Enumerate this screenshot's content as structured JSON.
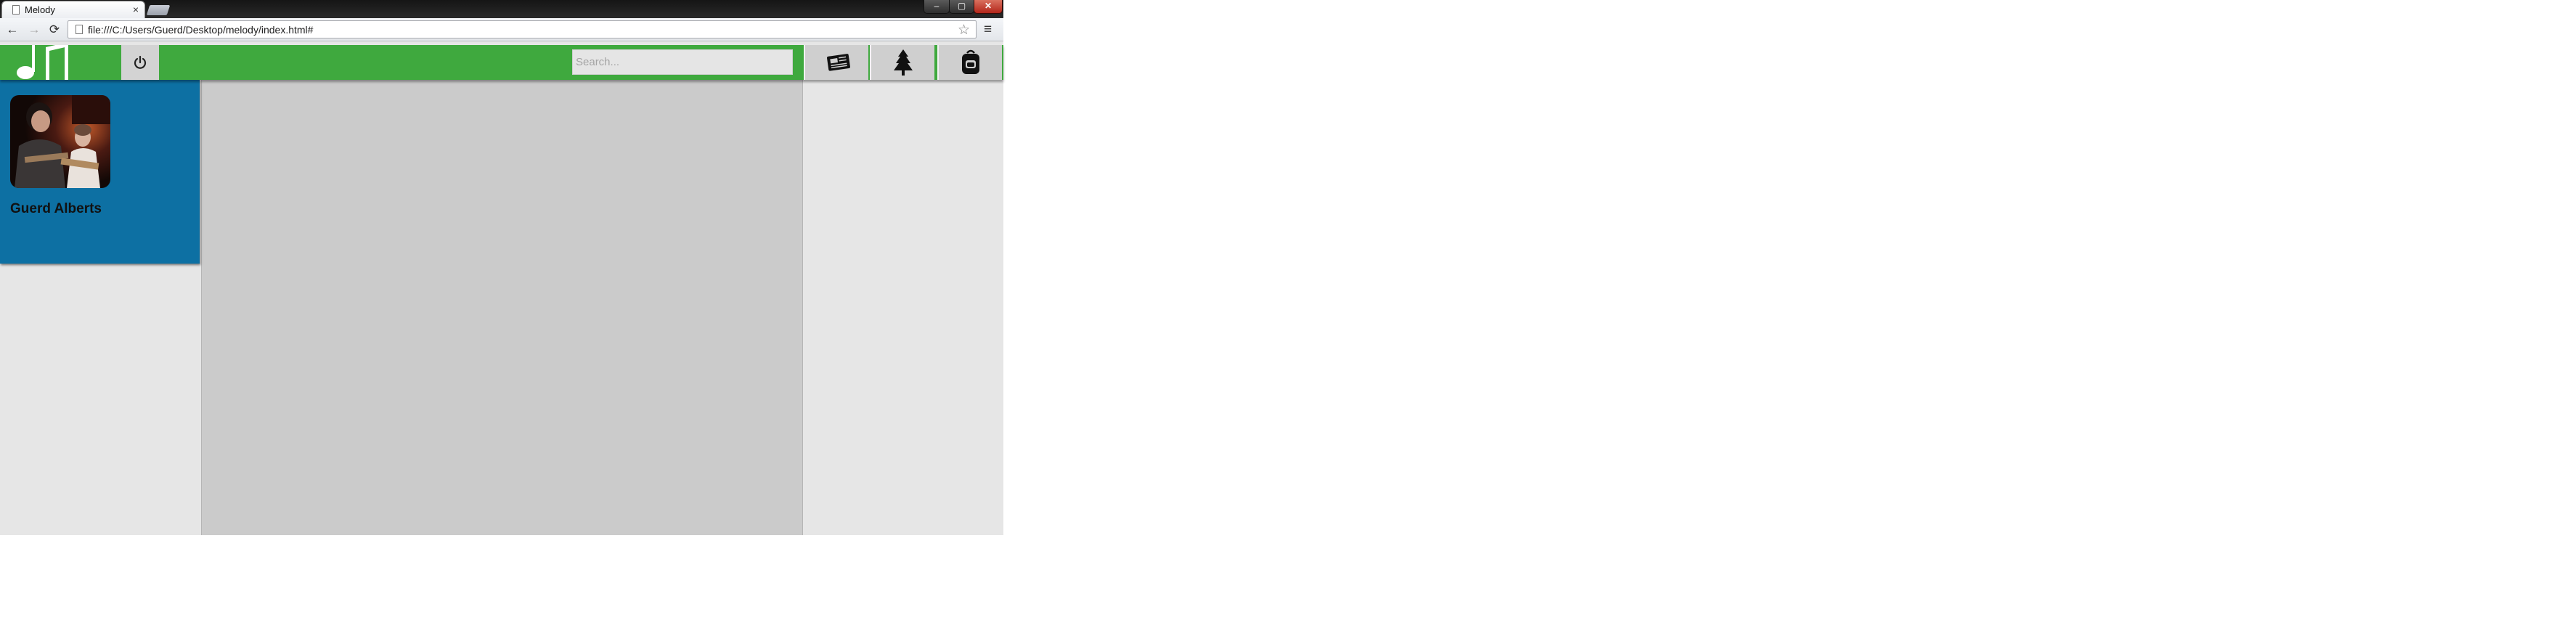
{
  "browser": {
    "tab_title": "Melody",
    "tab_close": "×",
    "url": "file:///C:/Users/Guerd/Desktop/melody/index.html#",
    "nav": {
      "back": "←",
      "forward": "→",
      "reload": "⟳",
      "star": "☆",
      "menu": "≡"
    },
    "window_controls": {
      "minimize": "–",
      "maximize": "▢",
      "close": "✕"
    }
  },
  "app": {
    "search": {
      "placeholder": "Search..."
    },
    "header_buttons": [
      "newspaper-icon",
      "tree-icon",
      "backpack-icon"
    ],
    "profile": {
      "name": "Guerd Alberts"
    },
    "colors": {
      "header": "#3fa93e",
      "profile_card": "#0d70a3",
      "center_panel": "#cbcbcb",
      "side_panels": "#e6e6e6"
    }
  }
}
